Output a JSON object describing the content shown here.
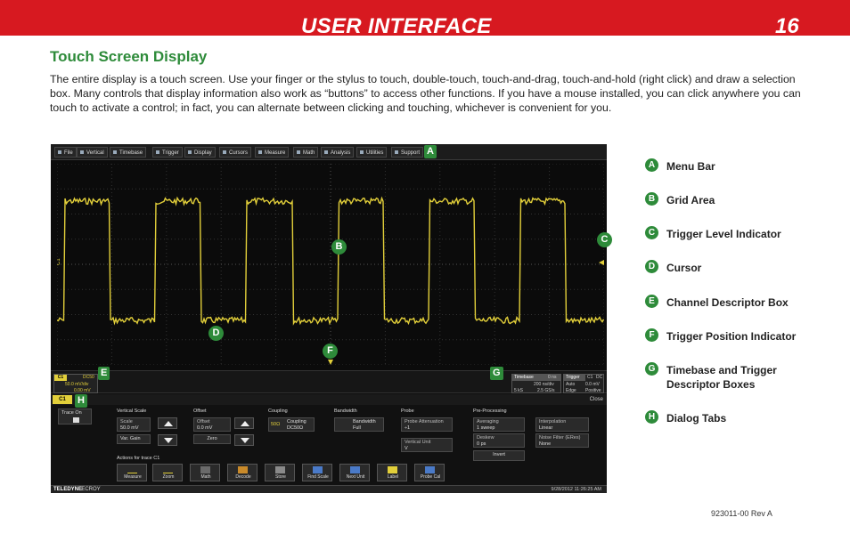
{
  "header": {
    "title": "USER INTERFACE",
    "page_number": "16"
  },
  "section_title": "Touch Screen Display",
  "intro": "The entire display is a touch screen. Use your finger or the stylus to touch, double-touch, touch-and-drag, touch-and-hold (right click) and draw a selection box. Many controls that display information also work as “buttons” to access other functions. If you have a mouse installed, you can click anywhere you can touch to activate a control; in fact, you can alternate between clicking and touching, whichever is convenient for you.",
  "scope": {
    "menu": [
      "File",
      "Vertical",
      "Timebase",
      "Trigger",
      "Display",
      "Cursors",
      "Measure",
      "Math",
      "Analysis",
      "Utilities",
      "Support"
    ],
    "trace_label": "C1",
    "channel": {
      "tag": "C1",
      "coupling": "DC50",
      "scale": "50.0 mV/div",
      "offset": "0.00 mV"
    },
    "timebase": {
      "label": "Timebase",
      "offset": "0 ns",
      "per_div": "200 ns/div",
      "samples": "5 kS",
      "rate": "2.5 GS/s"
    },
    "trigger": {
      "label": "Trigger",
      "channel": "C1",
      "coupling": "DC",
      "mode": "Auto",
      "level": "0.0 mV",
      "type": "Edge",
      "slope": "Positive"
    },
    "tab": {
      "label": "C1",
      "close": "Close"
    },
    "dialog": {
      "trace_on": "Trace On",
      "vertical_scale": "Vertical Scale",
      "scale_label": "Scale",
      "scale_value": "50.0 mV",
      "var_gain": "Var. Gain",
      "offset": "Offset",
      "offset_value": "0.0 mV",
      "zero": "Zero",
      "coupling": "Coupling",
      "coupling_value": "DC50Ω",
      "coupling_freq": "50Ω",
      "bandwidth": "Bandwidth",
      "bandwidth_limit": "Bandwidth",
      "bandwidth_value": "Full",
      "probe": "Probe",
      "probe_attenuation": "Probe Attenuation",
      "probe_attenuation_value": "÷1",
      "vertical_unit": "Vertical Unit",
      "vertical_unit_value": "V",
      "pre_processing": "Pre-Processing",
      "averaging": "Averaging",
      "averaging_value": "1 sweep",
      "interpolation": "Interpolation",
      "interpolation_value": "Linear",
      "deskew": "Deskew",
      "deskew_value": "0 ps",
      "noise_filter": "Noise Filter (ERes)",
      "noise_filter_value": "None",
      "invert": "Invert",
      "actions_label": "Actions for trace C1",
      "actions": [
        "Measure",
        "Zoom",
        "Math",
        "Decode",
        "Store",
        "Find Scale",
        "Next Unit",
        "Label",
        "Probe Cal"
      ]
    },
    "status": {
      "brand": "TELEDYNE",
      "brand_sub": "LECROY",
      "timestamp": "9/28/2012 11:26:25 AM"
    }
  },
  "callouts": [
    "A",
    "B",
    "C",
    "D",
    "E",
    "F",
    "G",
    "H"
  ],
  "legend": [
    {
      "letter": "A",
      "label": "Menu Bar"
    },
    {
      "letter": "B",
      "label": "Grid Area"
    },
    {
      "letter": "C",
      "label": "Trigger Level Indicator"
    },
    {
      "letter": "D",
      "label": "Cursor"
    },
    {
      "letter": "E",
      "label": "Channel Descriptor Box"
    },
    {
      "letter": "F",
      "label": "Trigger Position Indicator"
    },
    {
      "letter": "G",
      "label": "Timebase and Trigger Descriptor Boxes"
    },
    {
      "letter": "H",
      "label": "Dialog Tabs"
    }
  ],
  "footer_code": "923011-00 Rev A",
  "colors": {
    "accent_red": "#d71920",
    "accent_green": "#2e8b3a",
    "trace_yellow": "#e2cf3a"
  },
  "waveform": {
    "type": "square",
    "cycles": 6,
    "high_fraction": 0.5
  }
}
